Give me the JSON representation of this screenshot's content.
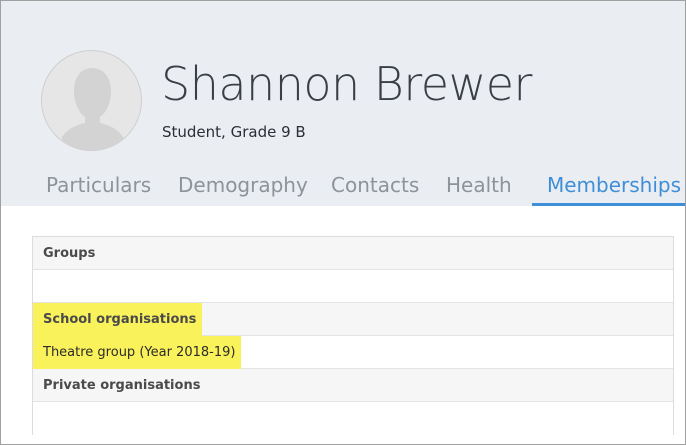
{
  "profile": {
    "name": "Shannon Brewer",
    "subtitle": "Student, Grade 9 B"
  },
  "tabs": [
    {
      "label": "Particulars",
      "active": false
    },
    {
      "label": "Demography",
      "active": false
    },
    {
      "label": "Contacts",
      "active": false
    },
    {
      "label": "Health",
      "active": false
    },
    {
      "label": "Memberships",
      "active": true
    }
  ],
  "memberships": {
    "groups_heading": "Groups",
    "school_heading": "School organisations",
    "school_items": [
      "Theatre group (Year 2018-19)"
    ],
    "private_heading": "Private organisations"
  },
  "colors": {
    "accent": "#3f8fd8",
    "highlight": "#faf25a",
    "header_bg": "#eaedf1"
  }
}
